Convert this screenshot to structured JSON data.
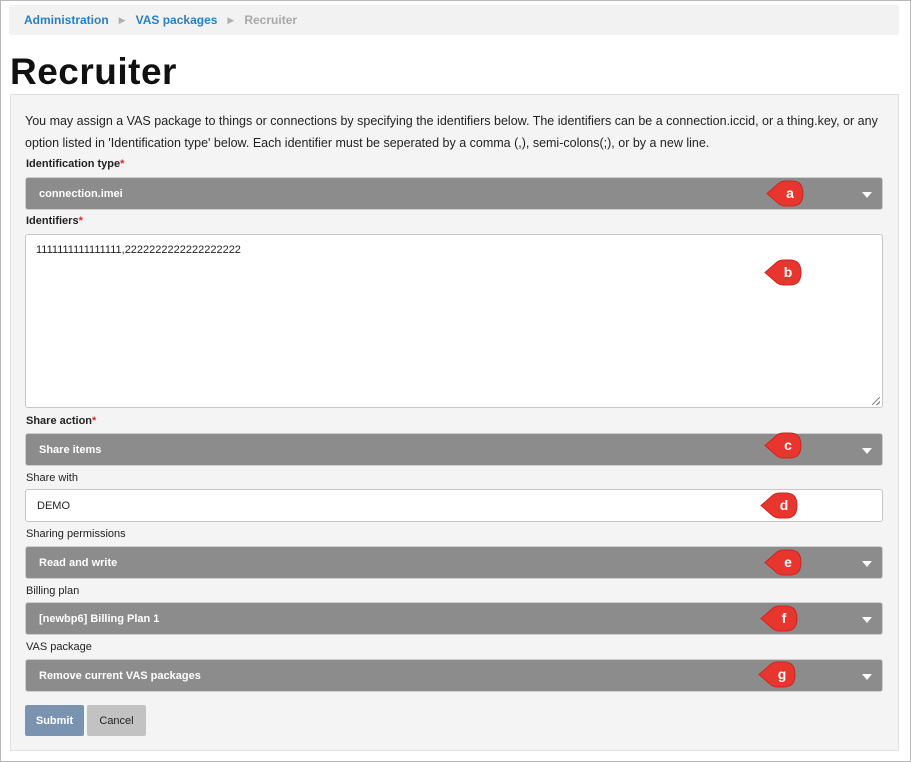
{
  "breadcrumb": {
    "items": [
      "Administration",
      "VAS packages"
    ],
    "current": "Recruiter"
  },
  "page": {
    "title": "Recruiter",
    "intro": "You may assign a VAS package to things or connections by specifying the identifiers below. The identifiers can be a connection.iccid, or a thing.key, or any option listed in 'Identification type' below. Each identifier must be seperated by a comma (,), semi-colons(;), or by a new line."
  },
  "form": {
    "identification_type": {
      "label": "Identification type",
      "required_mark": "*",
      "value": "connection.imei"
    },
    "identifiers": {
      "label": "Identifiers",
      "required_mark": "*",
      "value": "1111111111111111,2222222222222222222"
    },
    "share_action": {
      "label": "Share action",
      "required_mark": "*",
      "value": "Share items"
    },
    "share_with": {
      "label": "Share with",
      "value": "DEMO"
    },
    "sharing_permissions": {
      "label": "Sharing permissions",
      "value": "Read and write"
    },
    "billing_plan": {
      "label": "Billing plan",
      "value": "[newbp6] Billing Plan 1"
    },
    "vas_package": {
      "label": "VAS package",
      "value": "Remove current VAS packages"
    },
    "submit_label": "Submit",
    "cancel_label": "Cancel"
  },
  "annotations": [
    "a",
    "b",
    "c",
    "d",
    "e",
    "f",
    "g"
  ],
  "colors": {
    "select_bg": "#8c8c8c",
    "link": "#2a7fc0",
    "submit_bg": "#7a93b0",
    "cancel_bg": "#c2c2c2",
    "annotation_pin": "#e8352e",
    "required": "#d9262b"
  }
}
